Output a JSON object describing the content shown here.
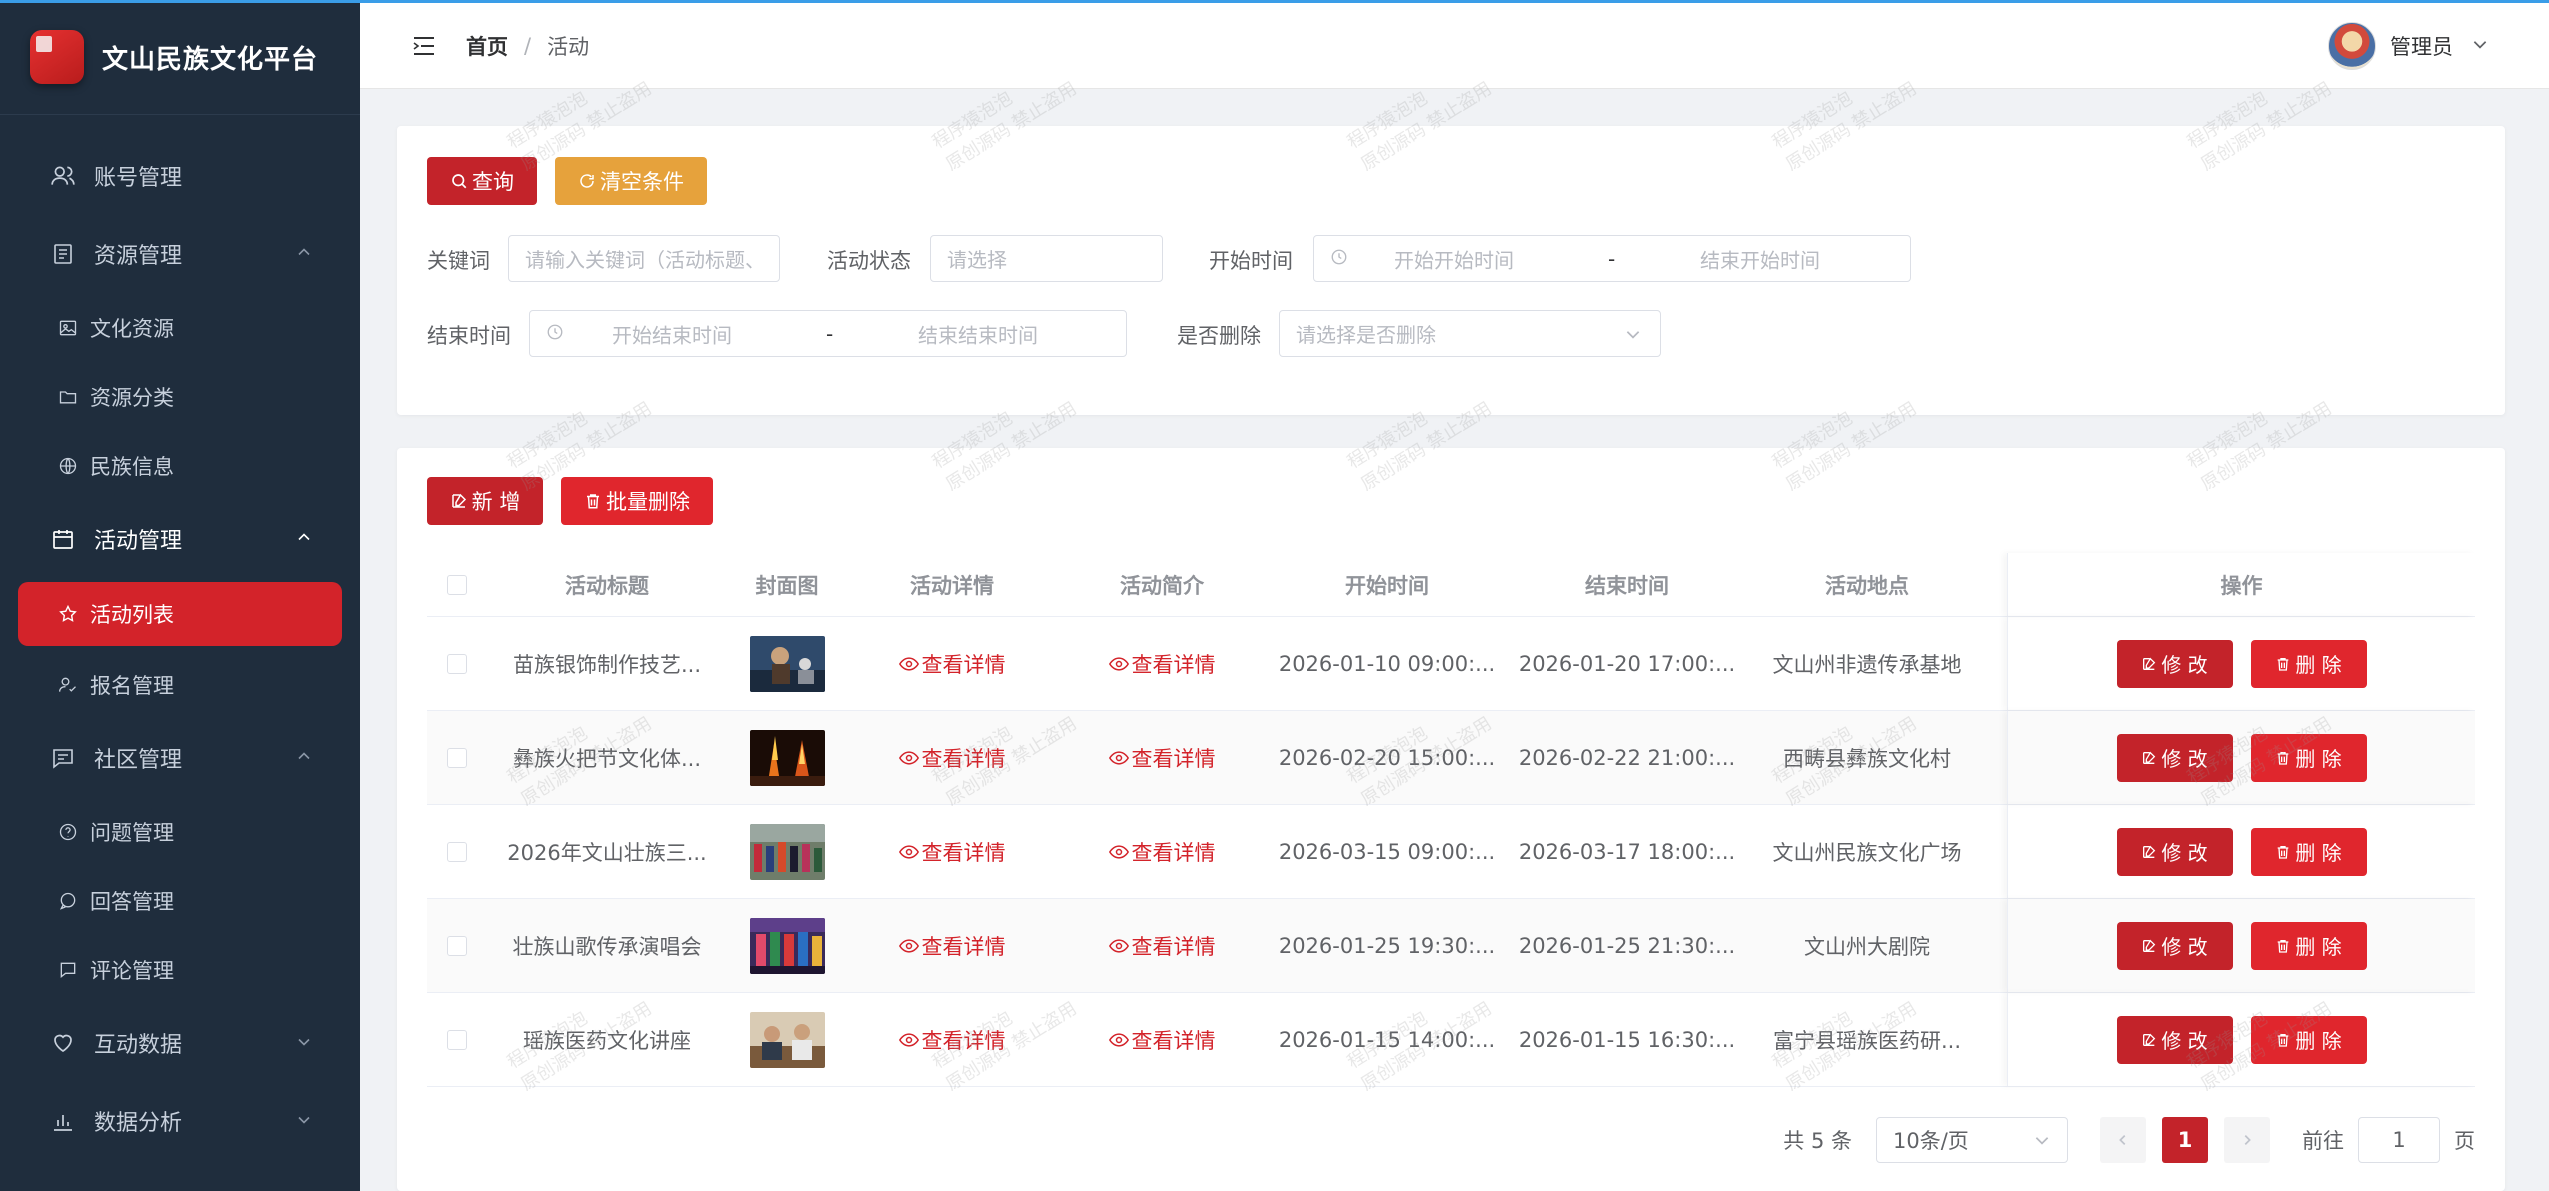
{
  "brand": {
    "title": "文山民族文化平台"
  },
  "colors": {
    "primary": "#c3232a",
    "sidebar": "#1f2d3d",
    "warning": "#e6a23c"
  },
  "sidebar": {
    "items": [
      {
        "label": "账号管理",
        "icon": "users-icon",
        "type": "item"
      },
      {
        "label": "资源管理",
        "icon": "document-icon",
        "type": "group",
        "open": true
      },
      {
        "label": "文化资源",
        "icon": "image-icon",
        "type": "sub"
      },
      {
        "label": "资源分类",
        "icon": "folder-icon",
        "type": "sub"
      },
      {
        "label": "民族信息",
        "icon": "globe-icon",
        "type": "sub"
      },
      {
        "label": "活动管理",
        "icon": "calendar-icon",
        "type": "group",
        "open": true
      },
      {
        "label": "活动列表",
        "icon": "star-icon",
        "type": "sub",
        "active": true
      },
      {
        "label": "报名管理",
        "icon": "user-check-icon",
        "type": "sub"
      },
      {
        "label": "社区管理",
        "icon": "chat-icon",
        "type": "group",
        "open": true
      },
      {
        "label": "问题管理",
        "icon": "question-icon",
        "type": "sub"
      },
      {
        "label": "回答管理",
        "icon": "bubble-icon",
        "type": "sub"
      },
      {
        "label": "评论管理",
        "icon": "comment-icon",
        "type": "sub"
      },
      {
        "label": "互动数据",
        "icon": "heart-icon",
        "type": "group",
        "open": false
      },
      {
        "label": "数据分析",
        "icon": "bar-chart-icon",
        "type": "group",
        "open": false
      }
    ]
  },
  "header": {
    "breadcrumb_home": "首页",
    "breadcrumb_sep": "/",
    "breadcrumb_current": "活动",
    "user_name": "管理员"
  },
  "search": {
    "query_label": "查询",
    "clear_label": "清空条件",
    "keyword_label": "关键词",
    "keyword_placeholder": "请输入关键词（活动标题、",
    "status_label": "活动状态",
    "status_placeholder": "请选择",
    "start_label": "开始时间",
    "start_from": "开始开始时间",
    "start_to": "结束开始时间",
    "end_label": "结束时间",
    "end_from": "开始结束时间",
    "end_to": "结束结束时间",
    "range_sep": "-",
    "deleted_label": "是否删除",
    "deleted_placeholder": "请选择是否删除"
  },
  "toolbar": {
    "add_label": "新 增",
    "batch_delete_label": "批量删除"
  },
  "table": {
    "headers": [
      "活动标题",
      "封面图",
      "活动详情",
      "活动简介",
      "开始时间",
      "结束时间",
      "活动地点",
      "操作"
    ],
    "detail_link": "查看详情",
    "edit_label": "修 改",
    "delete_label": "删 除",
    "rows": [
      {
        "title": "苗族银饰制作技艺...",
        "cover": "cover-silver",
        "start": "2026-01-10 09:00:...",
        "end": "2026-01-20 17:00:...",
        "location": "文山州非遗传承基地"
      },
      {
        "title": "彝族火把节文化体...",
        "cover": "cover-torch",
        "start": "2026-02-20 15:00:...",
        "end": "2026-02-22 21:00:...",
        "location": "西畴县彝族文化村"
      },
      {
        "title": "2026年文山壮族三...",
        "cover": "cover-festival",
        "start": "2026-03-15 09:00:...",
        "end": "2026-03-17 18:00:...",
        "location": "文山州民族文化广场"
      },
      {
        "title": "壮族山歌传承演唱会",
        "cover": "cover-singing",
        "start": "2026-01-25 19:30:...",
        "end": "2026-01-25 21:30:...",
        "location": "文山州大剧院"
      },
      {
        "title": "瑶族医药文化讲座",
        "cover": "cover-lecture",
        "start": "2026-01-15 14:00:...",
        "end": "2026-01-15 16:30:...",
        "location": "富宁县瑶族医药研..."
      }
    ]
  },
  "pagination": {
    "total_text": "共 5 条",
    "page_size": "10条/页",
    "current_page": "1",
    "goto_label": "前往",
    "goto_value": "1",
    "page_suffix": "页"
  },
  "watermark": {
    "line1": "程序猿泡泡",
    "line2": "原创源码 禁止盗用"
  }
}
